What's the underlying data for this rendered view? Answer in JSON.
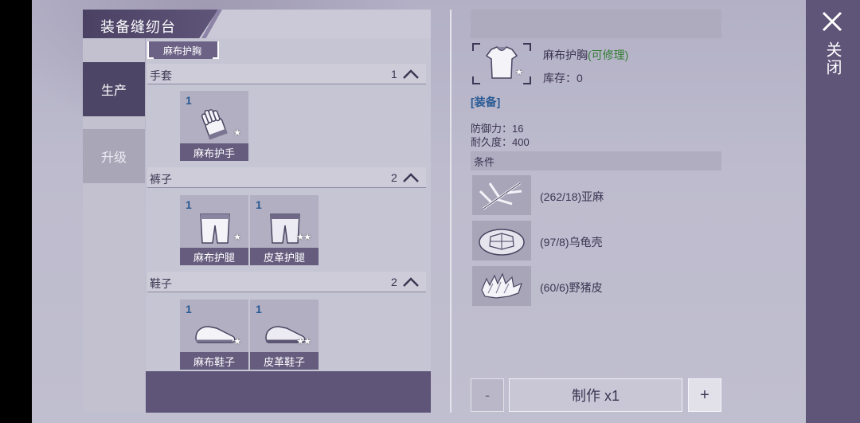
{
  "title": "装备缝纫台",
  "side_tabs": [
    {
      "label": "生产",
      "active": true
    },
    {
      "label": "升级",
      "active": false
    }
  ],
  "breadcrumb": "麻布护胸",
  "categories": [
    {
      "name": "手套",
      "count": "1",
      "items": [
        {
          "qty": "1",
          "name": "麻布护手",
          "stars": "★",
          "icon": "glove-icon"
        }
      ]
    },
    {
      "name": "裤子",
      "count": "2",
      "items": [
        {
          "qty": "1",
          "name": "麻布护腿",
          "stars": "★",
          "icon": "pants-icon"
        },
        {
          "qty": "1",
          "name": "皮革护腿",
          "stars": "★★",
          "icon": "pants-icon"
        }
      ]
    },
    {
      "name": "鞋子",
      "count": "2",
      "items": [
        {
          "qty": "1",
          "name": "麻布鞋子",
          "stars": "★",
          "icon": "shoe-icon"
        },
        {
          "qty": "1",
          "name": "皮革鞋子",
          "stars": "★★",
          "icon": "shoe-icon"
        }
      ]
    }
  ],
  "detail": {
    "name": "麻布护胸",
    "repairable": "(可修理)",
    "stock": "库存：0",
    "tag": "[装备]",
    "defense": "防御力：16",
    "durability": "耐久度：400",
    "conditions_label": "条件",
    "materials": [
      {
        "text": "(262/18)亚麻",
        "icon": "flax-icon"
      },
      {
        "text": "(97/8)乌龟壳",
        "icon": "turtle-shell-icon"
      },
      {
        "text": "(60/6)野猪皮",
        "icon": "boar-hide-icon"
      }
    ],
    "item_stars": "★",
    "icon": "chest-armor-icon"
  },
  "buttons": {
    "minus": "-",
    "make": "制作 x1",
    "plus": "+"
  },
  "close_label": "关闭",
  "colors": {
    "accent": "#5e5579",
    "qty_blue": "#285a94",
    "repair_green": "#2f7d2f"
  }
}
